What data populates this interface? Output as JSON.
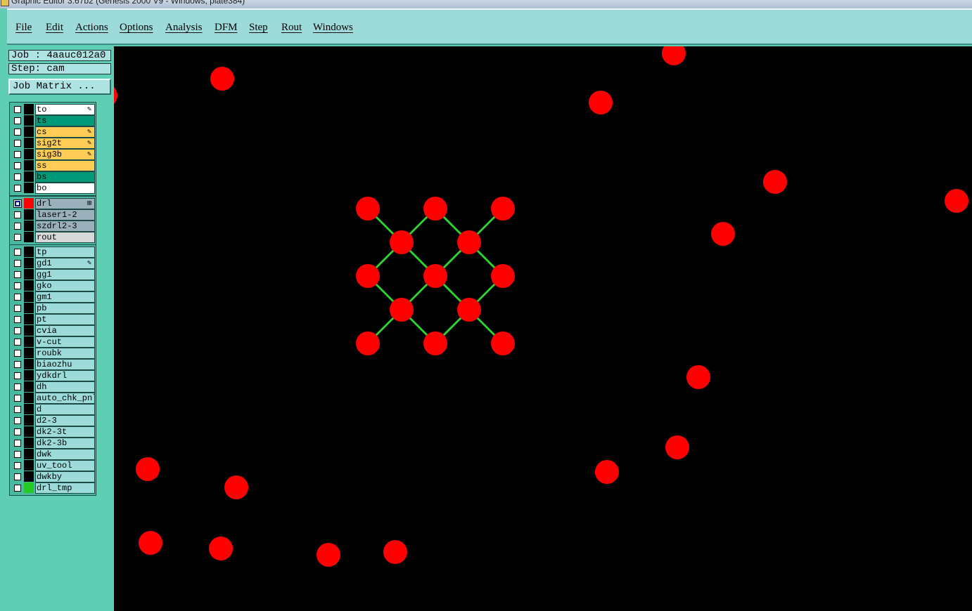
{
  "window": {
    "title": "Graphic Editor 3.67b2 (Genesis 2000 V9 - Windows, plate384)"
  },
  "menubar": {
    "items": [
      "File",
      "Edit",
      "Actions",
      "Options",
      "Analysis",
      "DFM",
      "Step",
      "Rout",
      "Windows"
    ]
  },
  "job": {
    "job_label": "Job : 4aauc012a0",
    "step_label": "Step: cam",
    "matrix_button": "Job Matrix ..."
  },
  "colors": {
    "pad": "#ff0000",
    "trace": "#32cd32",
    "canvas_bg": "#000000",
    "signal_layer": "#ffcc55",
    "solder_layer": "#009977",
    "drill_layer": "#9ab0bb",
    "doc_layer": "#9ddada"
  },
  "layers": {
    "board": [
      {
        "name": "to",
        "color": "#ffffff",
        "editable": true
      },
      {
        "name": "ts",
        "color": "#009977",
        "editable": false
      },
      {
        "name": "cs",
        "color": "#ffcc55",
        "editable": true
      },
      {
        "name": "sig2t",
        "color": "#ffcc55",
        "editable": true
      },
      {
        "name": "sig3b",
        "color": "#ffcc55",
        "editable": true
      },
      {
        "name": "ss",
        "color": "#ffcc55",
        "editable": false
      },
      {
        "name": "bs",
        "color": "#009977",
        "editable": false
      },
      {
        "name": "bo",
        "color": "#ffffff",
        "editable": false
      }
    ],
    "drill": [
      {
        "name": "drl",
        "color": "#9ab0bb",
        "active": true,
        "swatch": "#ff0000",
        "marker": "⊞"
      },
      {
        "name": "laser1-2",
        "color": "#9ab0bb"
      },
      {
        "name": "szdrl2-3",
        "color": "#9ab0bb"
      },
      {
        "name": "rout",
        "color": "#d8d8d8"
      }
    ],
    "doc": [
      {
        "name": "tp"
      },
      {
        "name": "gd1",
        "editable": true
      },
      {
        "name": "gg1"
      },
      {
        "name": "gko"
      },
      {
        "name": "gm1"
      },
      {
        "name": "pb"
      },
      {
        "name": "pt"
      },
      {
        "name": "cvia"
      },
      {
        "name": "v-cut"
      },
      {
        "name": "roubk"
      },
      {
        "name": "biaozhu"
      },
      {
        "name": "ydkdrl"
      },
      {
        "name": "dh"
      },
      {
        "name": "auto_chk_pnl"
      },
      {
        "name": "d"
      },
      {
        "name": "d2-3"
      },
      {
        "name": "dk2-3t"
      },
      {
        "name": "dk2-3b"
      },
      {
        "name": "dwk"
      },
      {
        "name": "uv_tool"
      },
      {
        "name": "dwkby"
      },
      {
        "name": "drl_tmp",
        "swatch": "#22cc22"
      }
    ]
  },
  "canvas": {
    "pad_count": 31,
    "trace_count": 16
  }
}
